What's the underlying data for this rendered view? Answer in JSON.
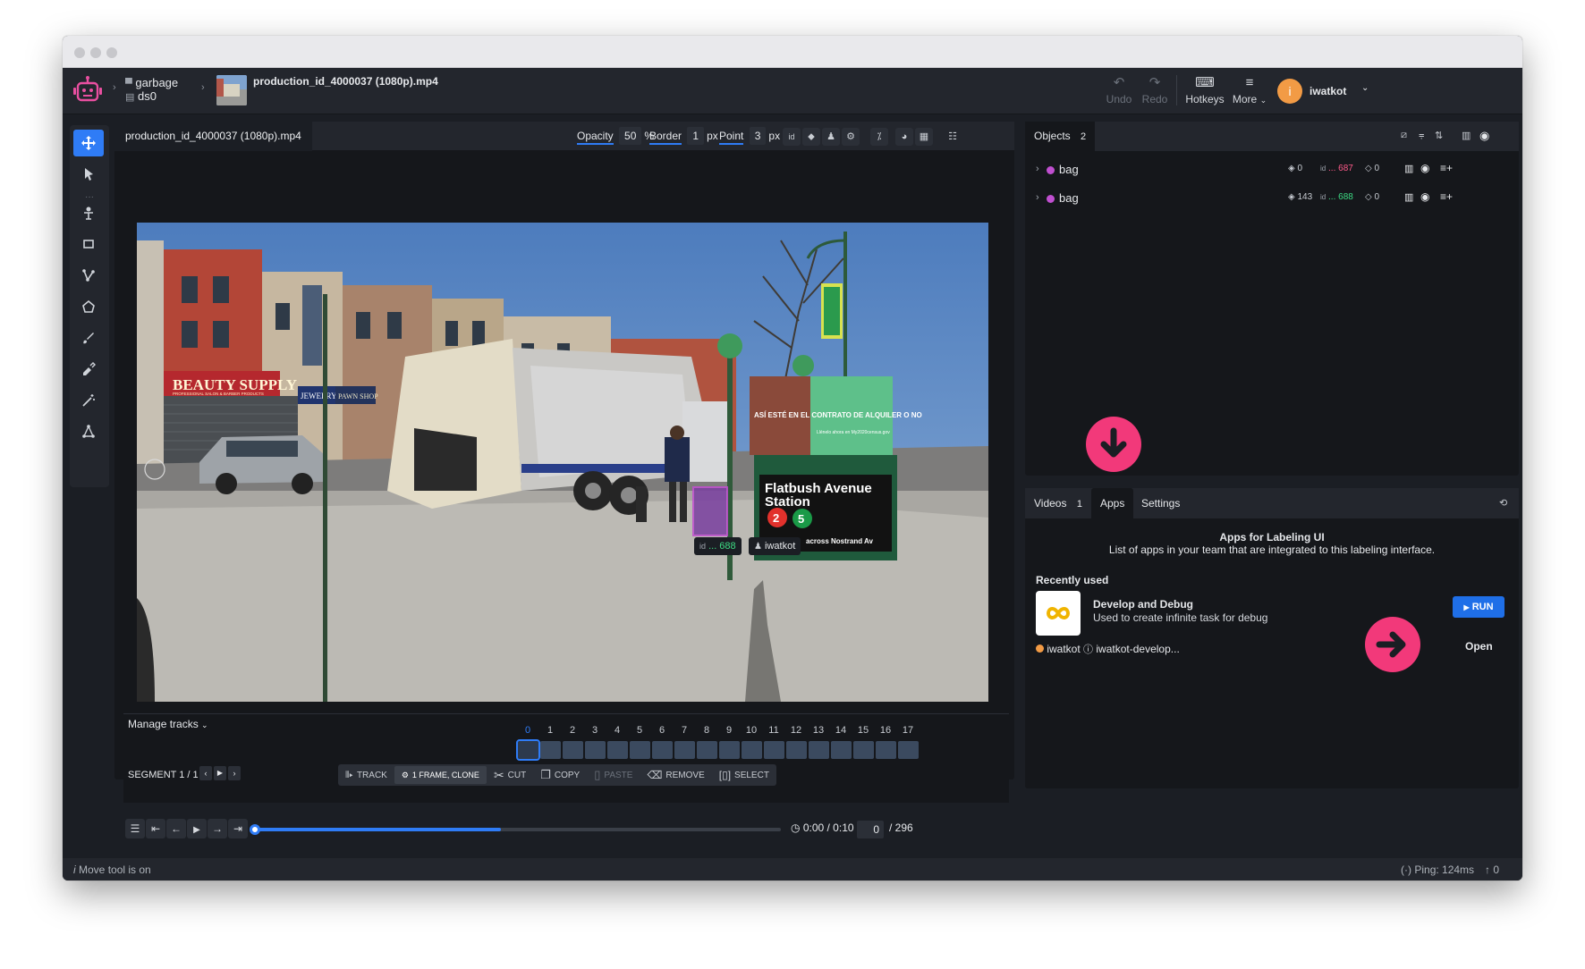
{
  "header": {
    "project": "garbage",
    "dataset": "ds0",
    "file_name": "production_id_4000037 (1080p).mp4",
    "undo_label": "Undo",
    "redo_label": "Redo",
    "hotkeys_label": "Hotkeys",
    "more_label": "More",
    "user_initial": "i",
    "user_name": "iwatkot"
  },
  "left_tools": [
    "move-icon",
    "pointer-icon",
    "point-icon",
    "rectangle-icon",
    "polyline-icon",
    "polygon-icon",
    "brush-icon",
    "eraser-icon",
    "magic-wand-icon",
    "graph-icon"
  ],
  "canvas_tab": {
    "file_tab": "production_id_4000037 (1080p).mp4",
    "opacity_label": "Opacity",
    "opacity_value": "50",
    "opacity_unit": "%",
    "border_label": "Border",
    "border_value": "1",
    "border_unit": "px",
    "point_label": "Point",
    "point_value": "3",
    "point_unit": "px",
    "id_chip": "id"
  },
  "scene": {
    "store_sign": "BEAUTY SUPPLY",
    "store_sub": "PROFESSIONAL SALON & BARBER PRODUCTS",
    "jewelry": "JEWELRY",
    "pawn": "PAWN SHOP",
    "station_line1": "Flatbush Avenue",
    "station_line2": "Station",
    "route_a": "2",
    "route_b": "5",
    "station_sub": "across Nostrand Av",
    "billboard_text": "ASÍ ESTÉ EN EL CONTRATO DE ALQUILER O NO",
    "billboard_small": "Llénelo ahora en My2020census.gov",
    "object_id_prefix": "id",
    "object_id": "... 688",
    "object_user": "iwatkot"
  },
  "timeline": {
    "manage_tracks": "Manage tracks",
    "segment": "SEGMENT 1 / 1",
    "frame_numbers": [
      "0",
      "1",
      "2",
      "3",
      "4",
      "5",
      "6",
      "7",
      "8",
      "9",
      "10",
      "11",
      "12",
      "13",
      "14",
      "15",
      "16",
      "17"
    ],
    "tools": {
      "track": "TRACK",
      "frame_clone": "1 FRAME, CLONE",
      "cut": "CUT",
      "copy": "COPY",
      "paste": "PASTE",
      "remove": "REMOVE",
      "select": "SELECT"
    }
  },
  "player": {
    "time": "0:00 / 0:10",
    "frame": "0",
    "total_frames": "/ 296",
    "progress": 0.1
  },
  "objects": {
    "title": "Objects",
    "count": "2",
    "items": [
      {
        "name": "bag",
        "points": "0",
        "id_prefix": "id",
        "id": "... 687",
        "tags": "0",
        "id_color": "#ff5a8a"
      },
      {
        "name": "bag",
        "points": "143",
        "id_prefix": "id",
        "id": "... 688",
        "tags": "0",
        "id_color": "#3ddc84"
      }
    ]
  },
  "apps_panel": {
    "tab_videos": "Videos",
    "videos_count": "1",
    "tab_apps": "Apps",
    "tab_settings": "Settings",
    "heading": "Apps for Labeling UI",
    "subheading": "List of apps in your team that are integrated to this labeling interface.",
    "recently_used": "Recently used",
    "app_name": "Develop and Debug",
    "app_desc": "Used to create infinite task for debug",
    "run_label": "RUN",
    "session_user": "iwatkot",
    "session_name": "iwatkot-develop...",
    "open_label": "Open"
  },
  "status": {
    "left": "Move tool is on",
    "ping": "Ping: 124ms",
    "uploads": "0"
  },
  "colors": {
    "accent": "#2f7cf6",
    "highlight": "#f2397a",
    "panel": "#23262d",
    "background": "#15171b"
  }
}
